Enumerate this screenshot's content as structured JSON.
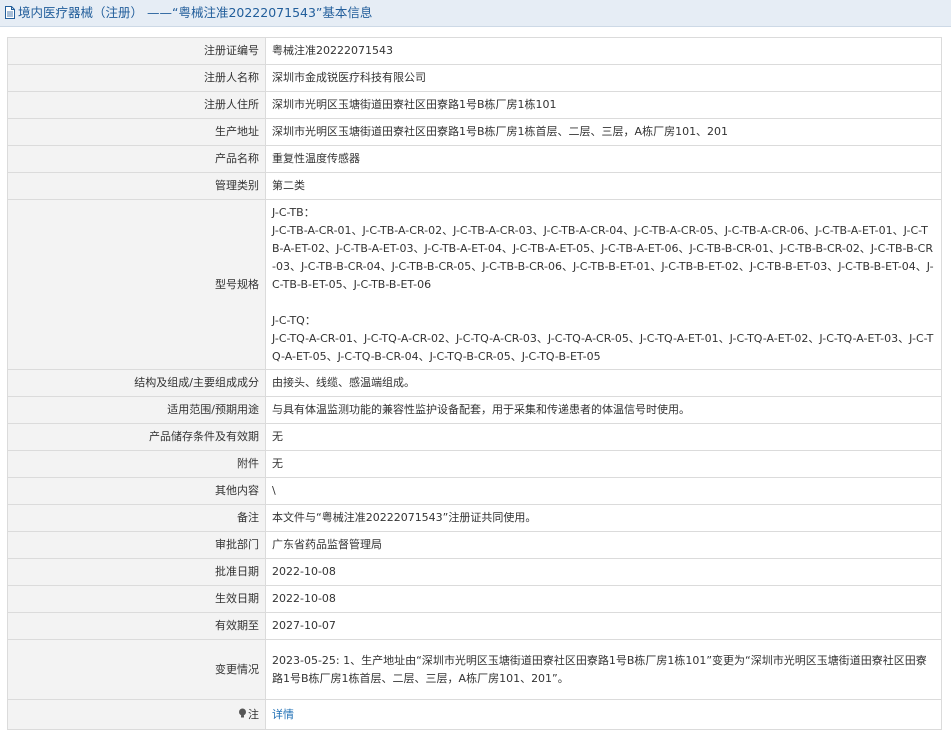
{
  "header": {
    "title": "境内医疗器械（注册） ——“粤械注准20222071543”基本信息",
    "icon": "document-icon"
  },
  "rows": [
    {
      "label": "注册证编号",
      "value": "粤械注准20222071543"
    },
    {
      "label": "注册人名称",
      "value": "深圳市金成锐医疗科技有限公司"
    },
    {
      "label": "注册人住所",
      "value": "深圳市光明区玉塘街道田寮社区田寮路1号B栋厂房1栋101"
    },
    {
      "label": "生产地址",
      "value": "深圳市光明区玉塘街道田寮社区田寮路1号B栋厂房1栋首层、二层、三层，A栋厂房101、201"
    },
    {
      "label": "产品名称",
      "value": "重复性温度传感器"
    },
    {
      "label": "管理类别",
      "value": "第二类"
    },
    {
      "label": "型号规格",
      "value": "J-C-TB：\nJ-C-TB-A-CR-01、J-C-TB-A-CR-02、J-C-TB-A-CR-03、J-C-TB-A-CR-04、J-C-TB-A-CR-05、J-C-TB-A-CR-06、J-C-TB-A-ET-01、J-C-TB-A-ET-02、J-C-TB-A-ET-03、J-C-TB-A-ET-04、J-C-TB-A-ET-05、J-C-TB-A-ET-06、J-C-TB-B-CR-01、J-C-TB-B-CR-02、J-C-TB-B-CR-03、J-C-TB-B-CR-04、J-C-TB-B-CR-05、J-C-TB-B-CR-06、J-C-TB-B-ET-01、J-C-TB-B-ET-02、J-C-TB-B-ET-03、J-C-TB-B-ET-04、J-C-TB-B-ET-05、J-C-TB-B-ET-06\n\nJ-C-TQ：\nJ-C-TQ-A-CR-01、J-C-TQ-A-CR-02、J-C-TQ-A-CR-03、J-C-TQ-A-CR-05、J-C-TQ-A-ET-01、J-C-TQ-A-ET-02、J-C-TQ-A-ET-03、J-C-TQ-A-ET-05、J-C-TQ-B-CR-04、J-C-TQ-B-CR-05、J-C-TQ-B-ET-05"
    },
    {
      "label": "结构及组成/主要组成成分",
      "value": "由接头、线缆、感温端组成。"
    },
    {
      "label": "适用范围/预期用途",
      "value": "与具有体温监测功能的兼容性监护设备配套，用于采集和传递患者的体温信号时使用。"
    },
    {
      "label": "产品储存条件及有效期",
      "value": "无"
    },
    {
      "label": "附件",
      "value": "无"
    },
    {
      "label": "其他内容",
      "value": "\\"
    },
    {
      "label": "备注",
      "value": "本文件与“粤械注准20222071543”注册证共同使用。"
    },
    {
      "label": "审批部门",
      "value": "广东省药品监督管理局"
    },
    {
      "label": "批准日期",
      "value": "2022-10-08"
    },
    {
      "label": "生效日期",
      "value": "2022-10-08"
    },
    {
      "label": "有效期至",
      "value": "2027-10-07"
    },
    {
      "label": "变更情况",
      "value": "2023-05-25: 1、生产地址由“深圳市光明区玉塘街道田寮社区田寮路1号B栋厂房1栋101”变更为“深圳市光明区玉塘街道田寮社区田寮路1号B栋厂房1栋首层、二层、三层，A栋厂房101、201”。"
    }
  ],
  "note": {
    "label": "注",
    "icon": "lightbulb-icon",
    "link_text": "详情"
  }
}
